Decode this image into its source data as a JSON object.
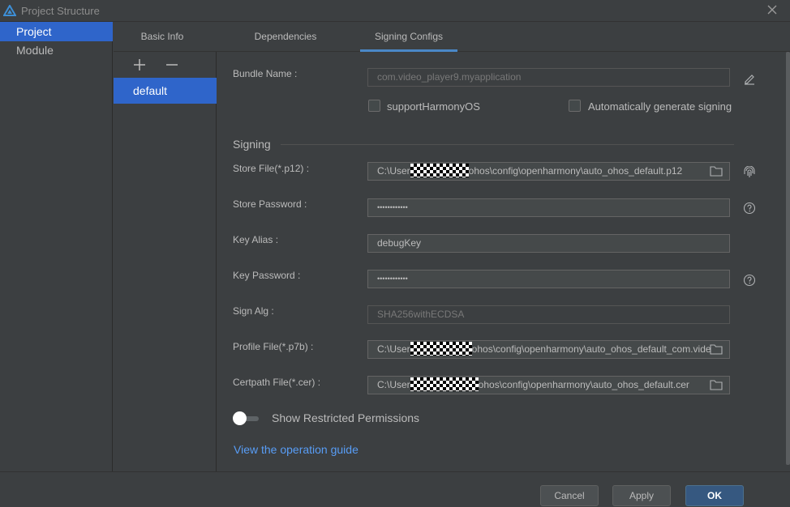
{
  "window": {
    "title": "Project Structure"
  },
  "nav": {
    "items": [
      {
        "label": "Project",
        "selected": true
      },
      {
        "label": "Module",
        "selected": false
      }
    ]
  },
  "tabs": [
    {
      "label": "Basic Info"
    },
    {
      "label": "Dependencies"
    },
    {
      "label": "Signing Configs",
      "active": true
    }
  ],
  "configs": {
    "items": [
      {
        "label": "default"
      }
    ]
  },
  "form": {
    "bundle_name": {
      "label": "Bundle Name :",
      "value": "com.video_player9.myapplication"
    },
    "support_harmony": {
      "label": "supportHarmonyOS",
      "checked": false
    },
    "auto_sign": {
      "label": "Automatically generate signing",
      "checked": false
    },
    "signing_section": "Signing",
    "store_file": {
      "label": "Store File(*.p12) :",
      "prefix": "C:\\User",
      "suffix": "ohos\\config\\openharmony\\auto_ohos_default.p12"
    },
    "store_password": {
      "label": "Store Password :",
      "value": "••••••••••••"
    },
    "key_alias": {
      "label": "Key Alias :",
      "value": "debugKey"
    },
    "key_password": {
      "label": "Key Password :",
      "value": "••••••••••••"
    },
    "sign_alg": {
      "label": "Sign Alg :",
      "value": "SHA256withECDSA"
    },
    "profile_file": {
      "label": "Profile File(*.p7b) :",
      "prefix": "C:\\User",
      "suffix": "ohos\\config\\openharmony\\auto_ohos_default_com.vide"
    },
    "certpath_file": {
      "label": "Certpath File(*.cer) :",
      "prefix": "C:\\User",
      "suffix": "ohos\\config\\openharmony\\auto_ohos_default.cer"
    },
    "restricted_toggle": {
      "label": "Show Restricted Permissions",
      "on": false
    },
    "guide_link": "View the operation guide"
  },
  "footer": {
    "cancel": "Cancel",
    "apply": "Apply",
    "ok": "OK"
  },
  "colors": {
    "accent": "#2f65ca",
    "link": "#589df6",
    "primary_button": "#365880",
    "background": "#3c3f41"
  }
}
